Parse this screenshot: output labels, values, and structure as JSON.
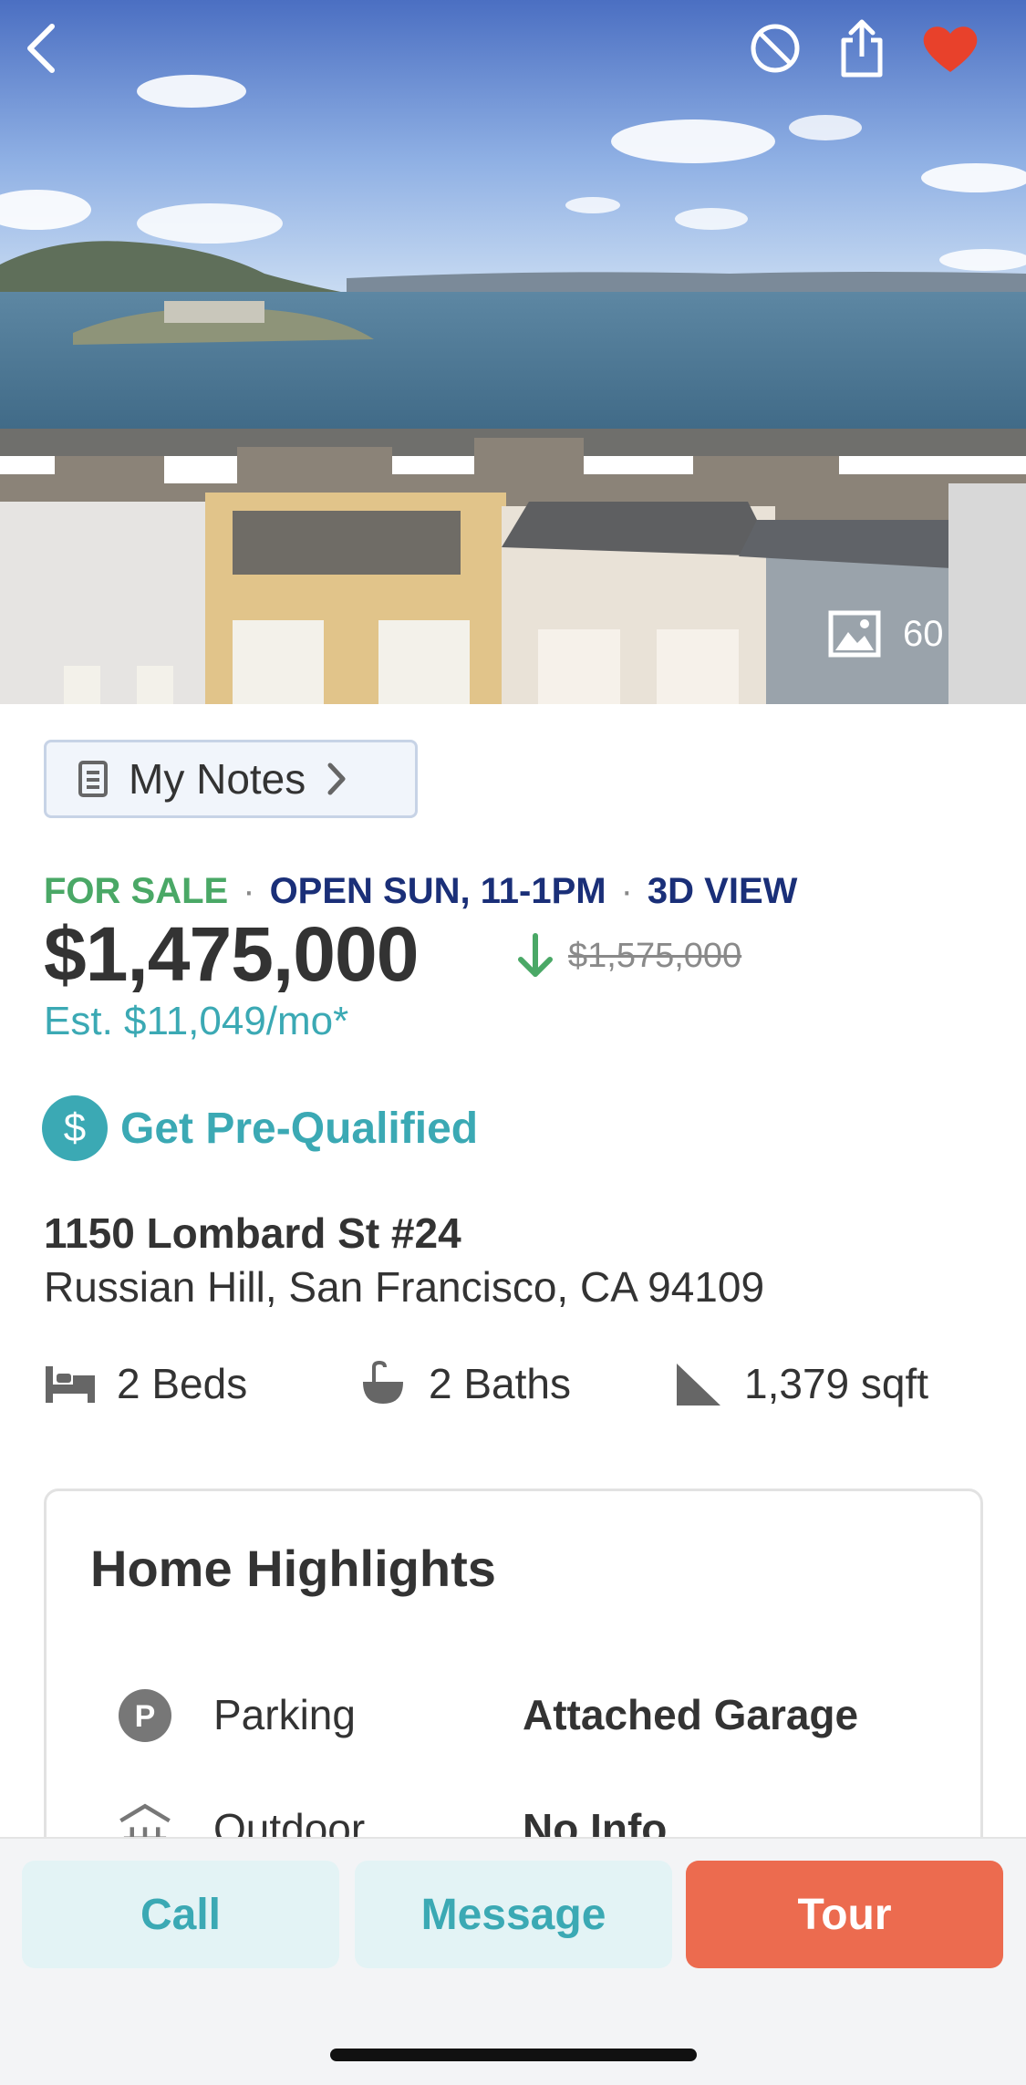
{
  "photo": {
    "count": "60"
  },
  "notes": {
    "label": "My Notes"
  },
  "status": {
    "for_sale": "FOR SALE",
    "open_house": "OPEN SUN, 11-1PM",
    "view_3d": "3D VIEW"
  },
  "price": {
    "current": "$1,475,000",
    "previous": "$1,575,000",
    "estimate": "Est. $11,049/mo*"
  },
  "prequal": {
    "icon_symbol": "$",
    "label": "Get Pre-Qualified"
  },
  "address": {
    "street": "1150 Lombard St #24",
    "locality": "Russian Hill, San Francisco, CA 94109"
  },
  "facts": {
    "beds": "2 Beds",
    "baths": "2 Baths",
    "sqft": "1,379 sqft"
  },
  "highlights": {
    "title": "Home Highlights",
    "rows": [
      {
        "icon": "parking-icon",
        "label": "Parking",
        "value": "Attached Garage"
      },
      {
        "icon": "outdoor-icon",
        "label": "Outdoor",
        "value": "No Info"
      }
    ]
  },
  "actions": {
    "call": "Call",
    "message": "Message",
    "tour": "Tour"
  },
  "colors": {
    "accent": "#3ba9b4",
    "for_sale": "#4aa866",
    "open_house": "#1a2f78",
    "tour": "#ec6b4f",
    "favorite": "#e8412b"
  }
}
